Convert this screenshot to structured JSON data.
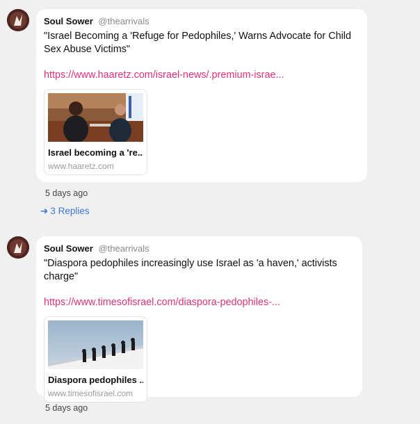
{
  "posts": [
    {
      "author": "Soul Sower",
      "handle": "@thearrivals",
      "text": "\"Israel Becoming a 'Refuge for Pedophiles,' Warns Advocate for Child Sex Abuse Victims\"",
      "link": "https://www.haaretz.com/israel-news/.premium-israe...",
      "card": {
        "title": "Israel becoming a 're...",
        "domain": "www.haaretz.com"
      },
      "time": "5 days ago",
      "replies": "3 Replies"
    },
    {
      "author": "Soul Sower",
      "handle": "@thearrivals",
      "text": "\"Diaspora pedophiles increasingly use Israel as 'a haven,' activists charge\"",
      "link": "https://www.timesofisrael.com/diaspora-pedophiles-...",
      "card": {
        "title": "Diaspora pedophiles ...",
        "domain": "www.timesofisrael.com"
      },
      "time": "5 days ago"
    }
  ],
  "colors": {
    "link": "#e0307a",
    "replies": "#3f78d8",
    "background": "#f0f0f1"
  }
}
